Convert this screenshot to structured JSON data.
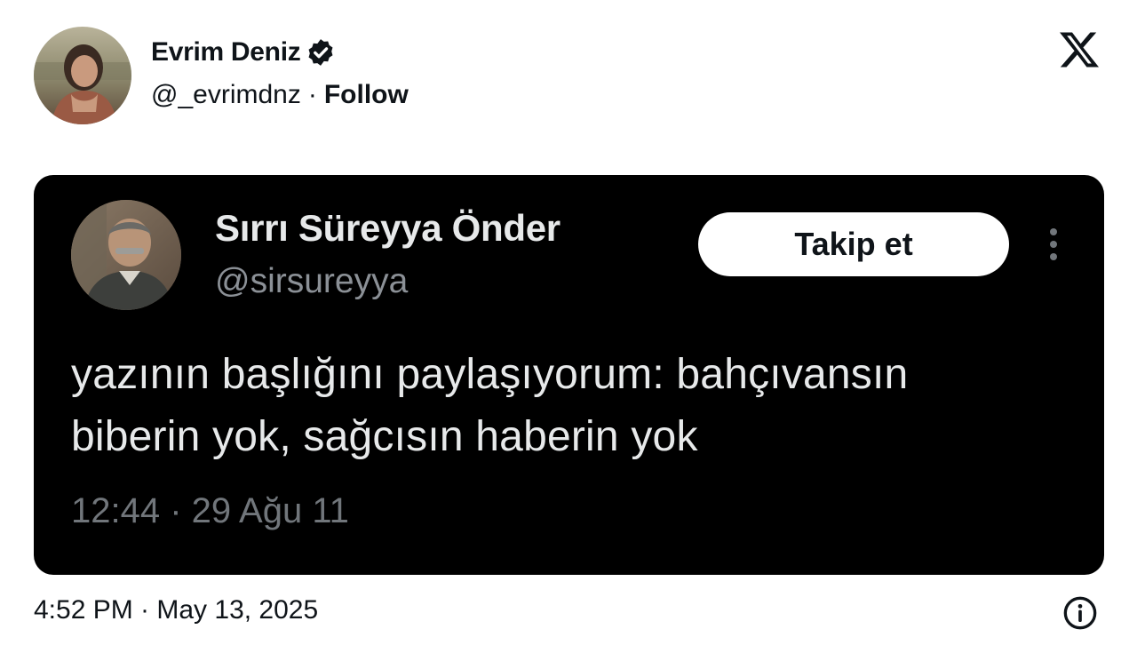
{
  "author": {
    "name": "Evrim Deniz",
    "handle": "@_evrimdnz",
    "separator": "·",
    "follow_label": "Follow",
    "verified": true
  },
  "brand": {
    "logo_icon": "x-logo-icon"
  },
  "embed": {
    "author_name": "Sırrı Süreyya Önder",
    "author_handle": "@sirsureyya",
    "follow_button_label": "Takip et",
    "text_line1": "yazının başlığını paylaşıyorum: bahçıvansın",
    "text_line2": "biberin yok, sağcısın haberin yok",
    "timestamp": "12:44 · 29 Ağu 11"
  },
  "footer": {
    "timestamp": "4:52 PM · May 13, 2025",
    "info_icon": "info-icon"
  },
  "colors": {
    "text_primary": "#0f1419",
    "embed_bg": "#000000",
    "embed_text": "#e7e9ea",
    "embed_muted": "#71767b"
  }
}
